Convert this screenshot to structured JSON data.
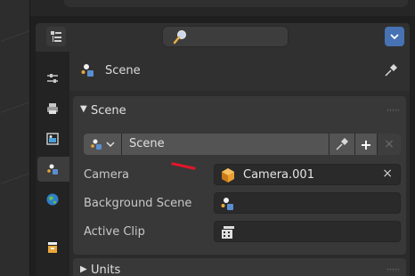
{
  "colors": {
    "accent": "#4772b3",
    "annotation_mark": "#e0172a"
  },
  "header": {
    "editor_type_icon": "properties-editor-icon",
    "search_icon": "search-icon",
    "options_icon": "chevron-down-icon"
  },
  "tabs": [
    {
      "icon": "tool-settings-icon",
      "active": false
    },
    {
      "icon": "output-printer-icon",
      "active": false
    },
    {
      "icon": "view-layer-icon",
      "active": false
    },
    {
      "icon": "scene-icon",
      "active": true
    },
    {
      "icon": "world-icon",
      "active": false
    },
    {
      "icon": "collection-icon",
      "active": false
    }
  ],
  "context": {
    "title": "Scene",
    "pin_icon": "pin-icon"
  },
  "scene_panel": {
    "title": "Scene",
    "datablock_name": "Scene",
    "add_label": "+",
    "remove_label": "×",
    "properties": [
      {
        "label": "Camera",
        "value": "Camera.001",
        "icon": "camera-object-icon",
        "clear": "×"
      },
      {
        "label": "Background Scene",
        "value": "",
        "icon": "scene-icon"
      },
      {
        "label": "Active Clip",
        "value": "",
        "icon": "movie-clip-icon"
      }
    ]
  },
  "units_panel": {
    "title": "Units"
  }
}
